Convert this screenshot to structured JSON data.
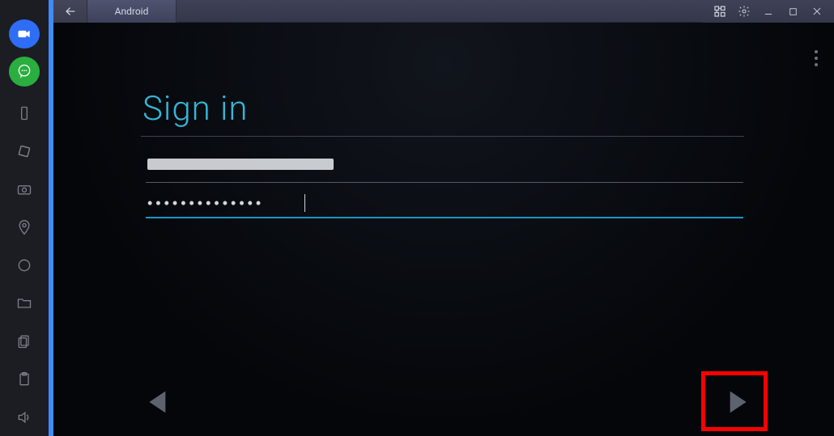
{
  "titlebar": {
    "tab_label": "Android"
  },
  "sidebar_icons": {
    "video": "video-camera-icon",
    "chat": "chat-icon",
    "phone": "phone-icon",
    "rotate": "rotate-icon",
    "camera": "camera-icon",
    "location": "location-icon",
    "apk": "apk-icon",
    "folder": "folder-icon",
    "copy": "copy-icon",
    "paste": "paste-icon",
    "volume": "volume-icon"
  },
  "window_controls": {
    "keymap": "keymap-icon",
    "settings": "gear-icon",
    "minimize": "minimize-icon",
    "maximize": "maximize-icon",
    "close": "close-icon"
  },
  "signin": {
    "title": "Sign in",
    "email_value": "",
    "password_value": "••••••••••••••",
    "overflow": "overflow-menu-icon"
  },
  "nav": {
    "back": "back-arrow-icon",
    "next": "next-arrow-icon"
  },
  "colors": {
    "accent_blue": "#3f8cff",
    "link_cyan": "#35b7d6",
    "input_focus": "#1796c4",
    "highlight": "#ff0000"
  }
}
